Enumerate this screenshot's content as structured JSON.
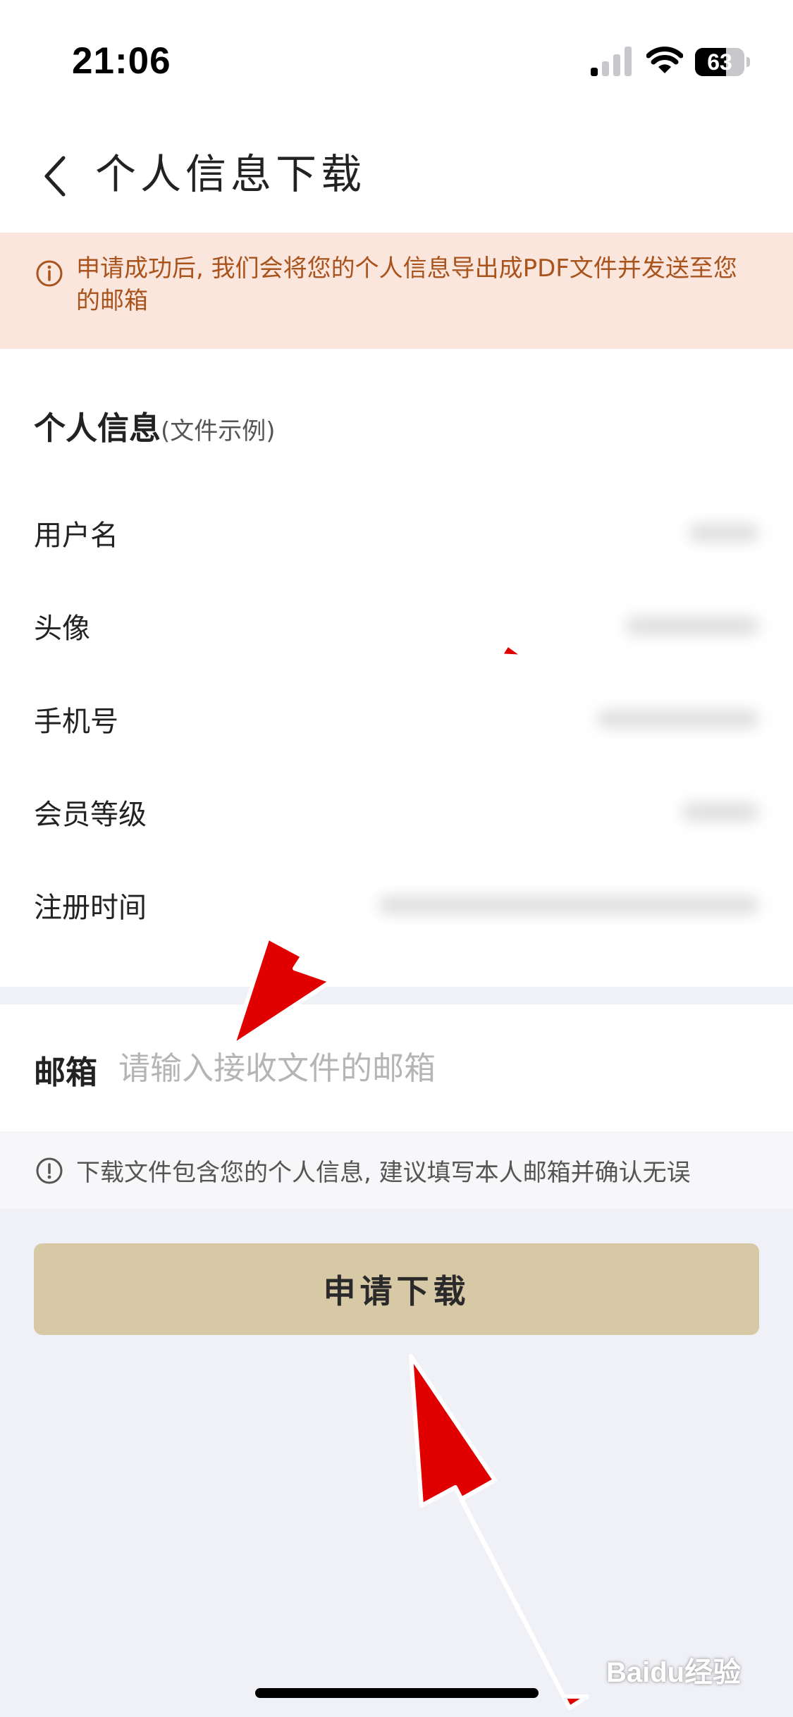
{
  "status_bar": {
    "time": "21:06",
    "battery_percent": 63,
    "battery_label": "63",
    "icons": [
      "signal-icon",
      "wifi-icon",
      "battery-icon"
    ]
  },
  "nav": {
    "back_icon": "chevron-left-icon",
    "title": "个人信息下载"
  },
  "notice": {
    "icon": "info-circle-icon",
    "text": "申请成功后, 我们会将您的个人信息导出成PDF文件并发送至您的邮箱"
  },
  "info_section": {
    "title": "个人信息",
    "subtitle": "(文件示例)",
    "rows": [
      {
        "label": "用户名"
      },
      {
        "label": "头像"
      },
      {
        "label": "手机号"
      },
      {
        "label": "会员等级"
      },
      {
        "label": "注册时间"
      }
    ]
  },
  "email": {
    "label": "邮箱",
    "value": "",
    "placeholder": "请输入接收文件的邮箱"
  },
  "hint": {
    "icon": "info-circle-icon",
    "text": "下载文件包含您的个人信息, 建议填写本人邮箱并确认无误"
  },
  "submit": {
    "label": "申请下载"
  },
  "watermark": {
    "text": "Baidu经验"
  },
  "colors": {
    "notice_bg": "#FBE6DD",
    "notice_text": "#A9531D",
    "button_bg": "#D7C8A6",
    "page_bg": "#F0F1F7",
    "annotation_arrow": "#E00000"
  }
}
